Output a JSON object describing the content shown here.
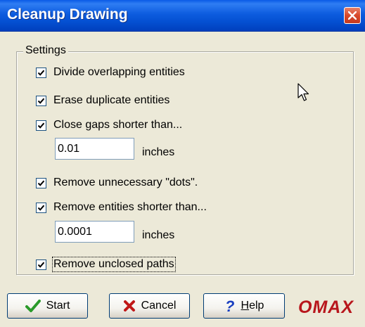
{
  "window": {
    "title": "Cleanup Drawing"
  },
  "settings": {
    "group_label": "Settings",
    "options": [
      {
        "label": "Divide overlapping entities",
        "checked": true
      },
      {
        "label": "Erase duplicate entities",
        "checked": true
      },
      {
        "label": "Close gaps shorter than...",
        "checked": true
      },
      {
        "label": "Remove unnecessary \"dots\".",
        "checked": true
      },
      {
        "label": "Remove entities shorter than...",
        "checked": true
      },
      {
        "label": "Remove unclosed paths",
        "checked": true
      }
    ],
    "gap_value": "0.01",
    "gap_unit": "inches",
    "short_value": "0.0001",
    "short_unit": "inches"
  },
  "buttons": {
    "start_label": "Start",
    "cancel_label": "Cancel",
    "help_mnemonic": "H",
    "help_rest": "elp"
  },
  "logo": {
    "text": "OMAX"
  },
  "colors": {
    "titlebar": "#0450d2",
    "dialog_bg": "#ece9d8",
    "close": "#d8482a",
    "logo": "#b8161c",
    "start_check": "#2a9a2a",
    "cancel_x": "#c01818",
    "help_q": "#1a3fc0"
  }
}
